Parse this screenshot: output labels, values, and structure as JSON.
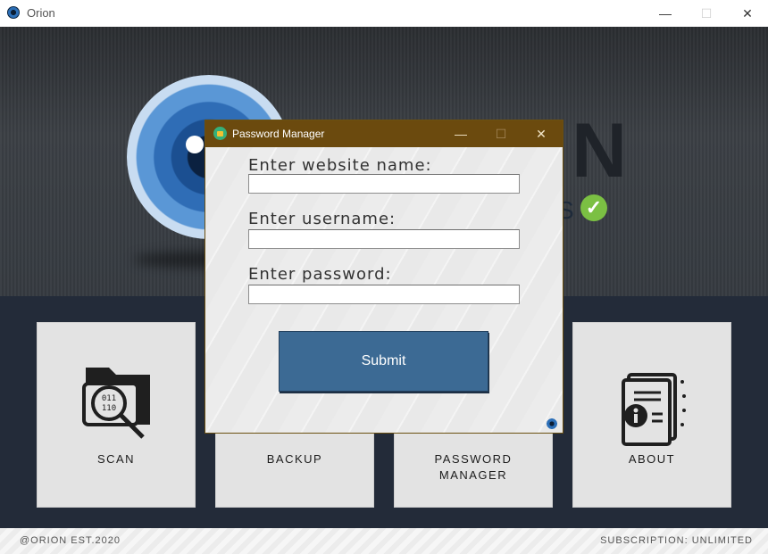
{
  "window": {
    "title": "Orion",
    "controls": {
      "minimize": "—",
      "maximize": "☐",
      "close": "✕"
    }
  },
  "hero": {
    "letter_n": "N",
    "letter_s": "S",
    "check_glyph": "✓",
    "check_color": "#7bc043"
  },
  "tiles": [
    {
      "id": "scan",
      "label": "SCAN",
      "icon": "folder-search-icon"
    },
    {
      "id": "backup",
      "label": "BACKUP",
      "icon": "backup-icon"
    },
    {
      "id": "password-manager",
      "label_line1": "PASSWORD",
      "label_line2": "MANAGER",
      "icon": "gear-icon"
    },
    {
      "id": "about",
      "label": "ABOUT",
      "icon": "document-info-icon"
    }
  ],
  "footer": {
    "left": "@ORION EST.2020",
    "right": "SUBSCRIPTION: UNLIMITED"
  },
  "dialog": {
    "title": "Password Manager",
    "controls": {
      "minimize": "—",
      "maximize": "☐",
      "close": "✕"
    },
    "fields": [
      {
        "label": "Enter website name:",
        "value": ""
      },
      {
        "label": "Enter username:",
        "value": ""
      },
      {
        "label": "Enter password:",
        "value": ""
      }
    ],
    "submit_label": "Submit"
  },
  "colors": {
    "dialog_titlebar": "#6b4a0e",
    "submit_button": "#3c6a94",
    "panel_bg": "#232b39",
    "tile_bg": "#e3e3e3"
  }
}
